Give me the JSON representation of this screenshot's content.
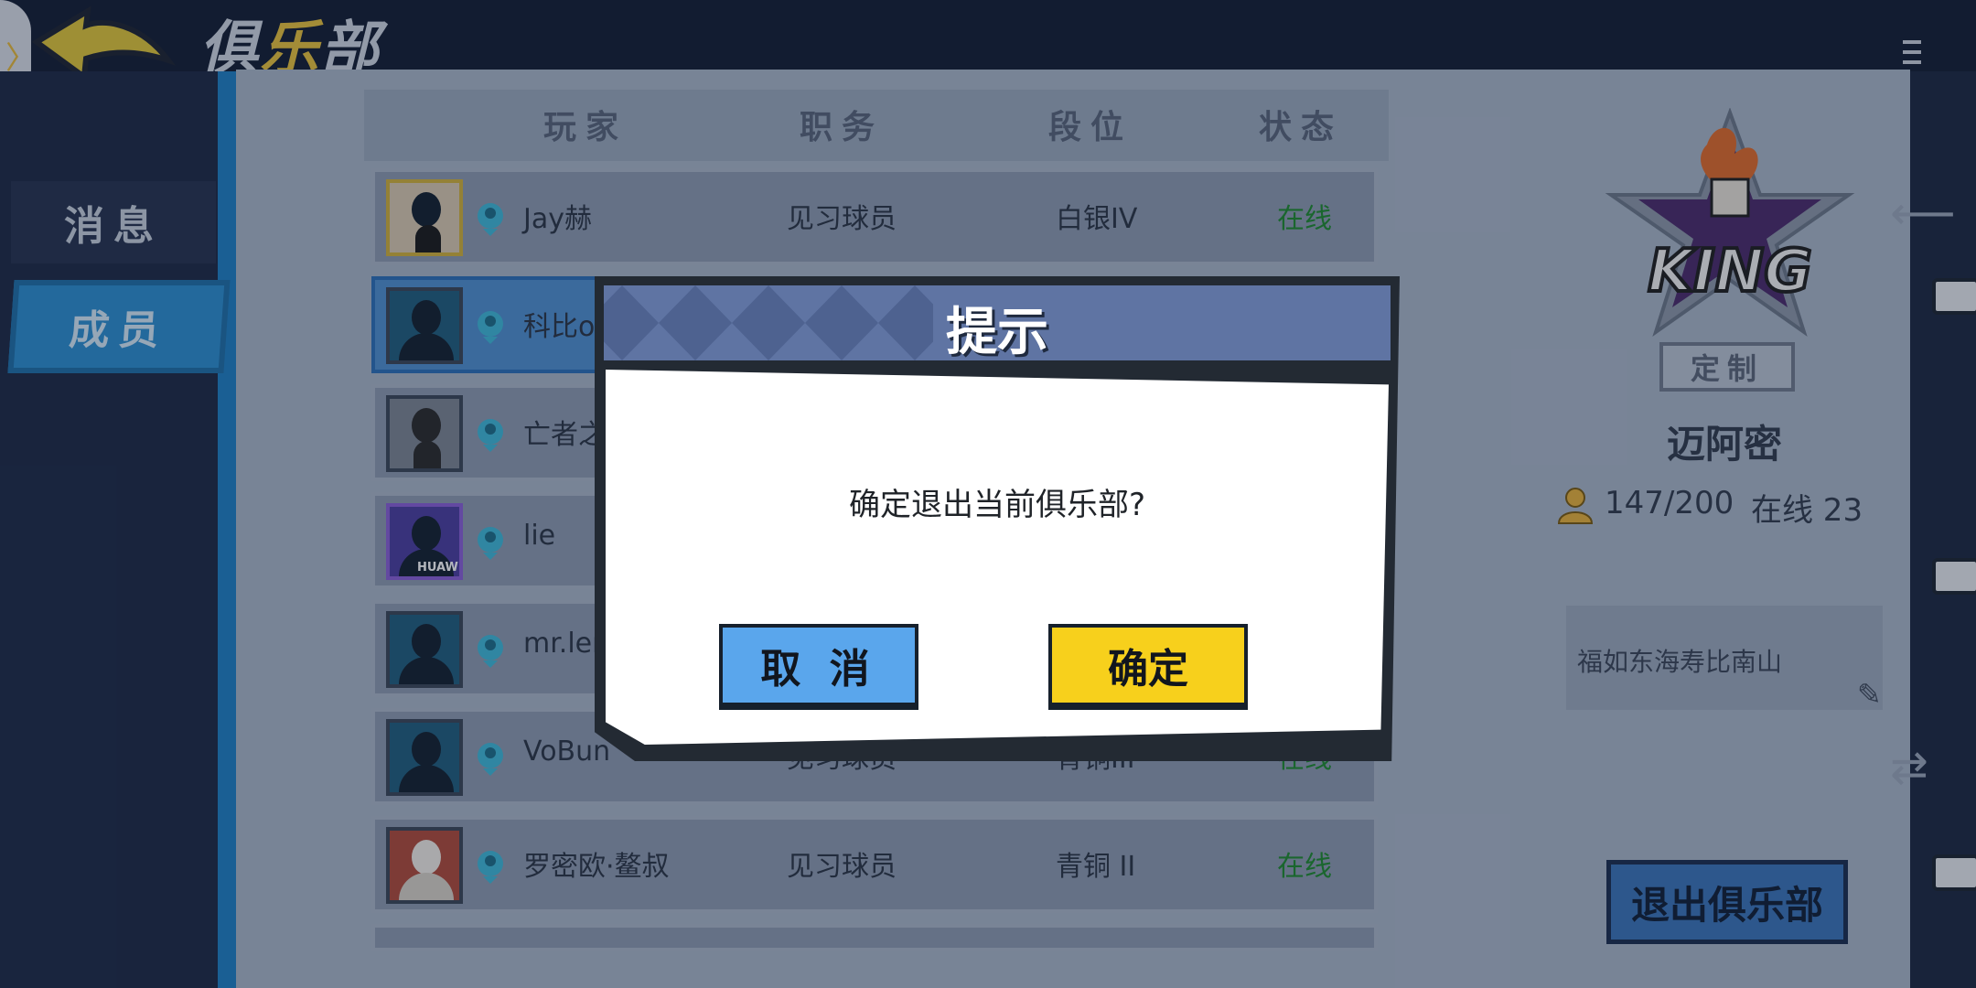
{
  "header": {
    "title_part1": "俱",
    "title_part2": "乐",
    "title_part3": "部",
    "drawer_glyph": "〉"
  },
  "nav": {
    "items": [
      {
        "label": "消息"
      },
      {
        "label": "成员"
      }
    ]
  },
  "table": {
    "columns": [
      "玩家",
      "职务",
      "段位",
      "状态"
    ],
    "rows": [
      {
        "name": "Jay赫",
        "role": "见习球员",
        "tier": "白银IV",
        "status": "在线"
      },
      {
        "name": "科比o花",
        "role": "",
        "tier": "",
        "status": ""
      },
      {
        "name": "亡者之",
        "role": "",
        "tier": "",
        "status": ""
      },
      {
        "name": "lie",
        "role": "",
        "tier": "",
        "status": ""
      },
      {
        "name": "mr.len",
        "role": "",
        "tier": "",
        "status": ""
      },
      {
        "name": "VoBun",
        "role": "见习球员",
        "tier": "青铜III",
        "status": "在线"
      },
      {
        "name": "罗密欧·鳌叔",
        "role": "见习球员",
        "tier": "青铜 II",
        "status": "在线"
      }
    ],
    "avatar_brand": "HUAWEI"
  },
  "club": {
    "logo_text": "KING",
    "customize_label": "定制",
    "name": "迈阿密",
    "member_count": "147/200",
    "online_label": "在线 23",
    "motto": "福如东海寿比南山",
    "quit_label": "退出俱乐部"
  },
  "dialog": {
    "title": "提示",
    "message": "确定退出当前俱乐部?",
    "cancel_label": "取 消",
    "confirm_label": "确定"
  },
  "colors": {
    "online": "#1e8a2e",
    "confirm": "#f7d01c",
    "cancel": "#5aa6ec",
    "header": "#5f74a3"
  }
}
